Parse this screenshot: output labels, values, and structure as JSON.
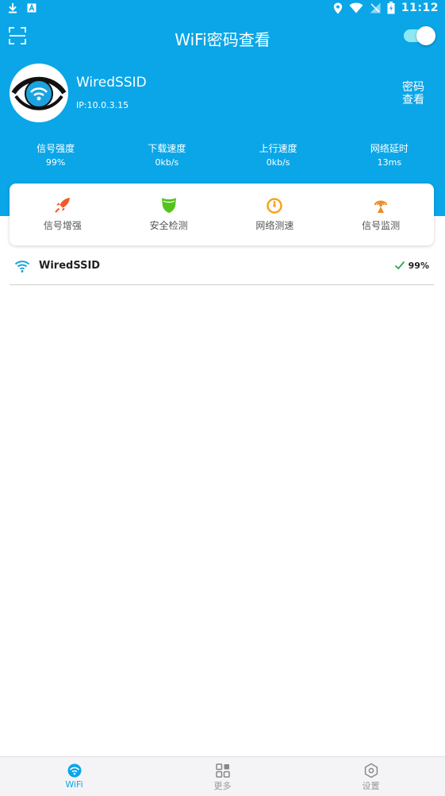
{
  "status_bar": {
    "time": "11:12"
  },
  "header": {
    "title": "WiFi密码查看",
    "toggle_on": true
  },
  "profile": {
    "ssid": "WiredSSID",
    "ip": "IP:10.0.3.15",
    "password_button": "密码查看"
  },
  "stats": [
    {
      "label": "信号强度",
      "value": "99%"
    },
    {
      "label": "下载速度",
      "value": "0kb/s"
    },
    {
      "label": "上行速度",
      "value": "0kb/s"
    },
    {
      "label": "网络延时",
      "value": "13ms"
    }
  ],
  "tools": [
    {
      "label": "信号增强",
      "icon": "rocket-icon",
      "color": "#f05a28"
    },
    {
      "label": "安全检测",
      "icon": "shield-icon",
      "color": "#52c41a"
    },
    {
      "label": "网络测速",
      "icon": "speedometer-icon",
      "color": "#f5a623"
    },
    {
      "label": "信号监测",
      "icon": "signal-tower-icon",
      "color": "#f08a24"
    }
  ],
  "wifi_list": [
    {
      "ssid": "WiredSSID",
      "strength": "99%",
      "connected": true
    }
  ],
  "bottom_nav": [
    {
      "label": "WiFi",
      "icon": "wifi-icon",
      "active": true
    },
    {
      "label": "更多",
      "icon": "grid-icon",
      "active": false
    },
    {
      "label": "设置",
      "icon": "settings-icon",
      "active": false
    }
  ],
  "colors": {
    "primary": "#0aa6e8",
    "toggle_track": "#8ee8f4",
    "check": "#2aa655"
  }
}
